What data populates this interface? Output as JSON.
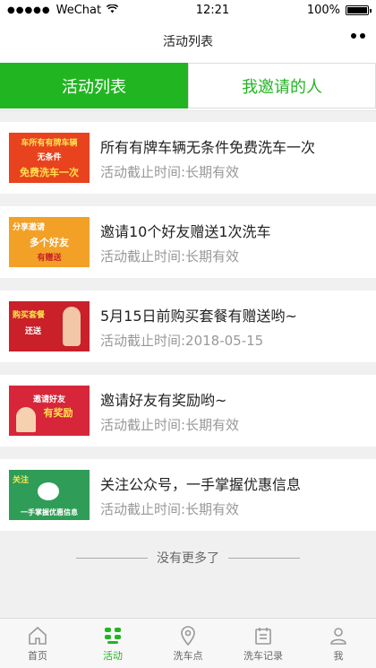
{
  "status": {
    "carrier": "WeChat",
    "time": "12:21",
    "battery": "100%"
  },
  "navbar": {
    "title": "活动列表"
  },
  "tabs": [
    {
      "label": "活动列表",
      "active": true
    },
    {
      "label": "我邀请的人",
      "active": false
    }
  ],
  "activities": [
    {
      "title": "所有有牌车辆无条件免费洗车一次",
      "deadline": "活动截止时间:长期有效",
      "thumb_lines": [
        "车所有有牌车辆",
        "无条件",
        "免费洗车一次"
      ],
      "thumb_bg": "#e8431e"
    },
    {
      "title": "邀请10个好友赠送1次洗车",
      "deadline": "活动截止时间:长期有效",
      "thumb_lines": [
        "分享邀请",
        "多个好友",
        "有赠送"
      ],
      "thumb_bg": "#f2a126"
    },
    {
      "title": "5月15日前购买套餐有赠送哟~",
      "deadline": "活动截止时间:2018-05-15",
      "thumb_lines": [
        "购买套餐",
        "还送"
      ],
      "thumb_bg": "#c9202a"
    },
    {
      "title": "邀请好友有奖励哟~",
      "deadline": "活动截止时间:长期有效",
      "thumb_lines": [
        "邀请好友",
        "有奖励"
      ],
      "thumb_bg": "#d7263a"
    },
    {
      "title": "关注公众号，一手掌握优惠信息",
      "deadline": "活动截止时间:长期有效",
      "thumb_lines": [
        "关注",
        "一手掌握优惠信息"
      ],
      "thumb_bg": "#2f9d57"
    }
  ],
  "no_more": "没有更多了",
  "tabbar": [
    {
      "label": "首页",
      "icon": "home-icon",
      "active": false
    },
    {
      "label": "活动",
      "icon": "activity-icon",
      "active": true
    },
    {
      "label": "洗车点",
      "icon": "location-icon",
      "active": false
    },
    {
      "label": "洗车记录",
      "icon": "record-icon",
      "active": false
    },
    {
      "label": "我",
      "icon": "user-icon",
      "active": false
    }
  ]
}
